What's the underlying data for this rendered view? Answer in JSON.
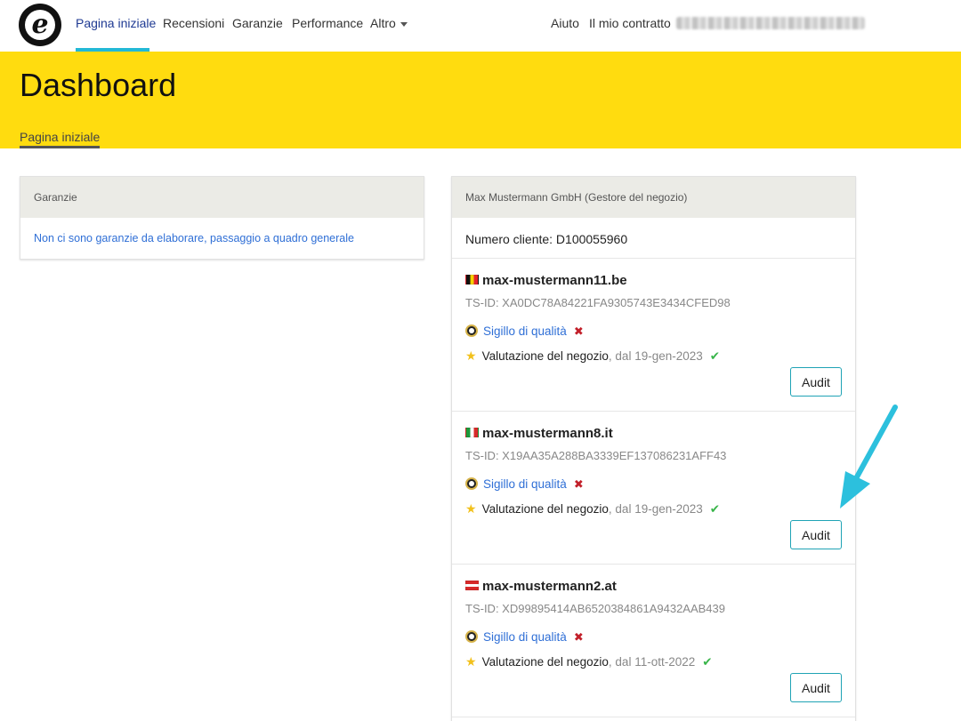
{
  "nav": {
    "logo_letter": "e",
    "items": [
      {
        "label": "Pagina iniziale",
        "active": true
      },
      {
        "label": "Recensioni"
      },
      {
        "label": "Garanzie"
      },
      {
        "label": "Performance"
      },
      {
        "label": "Altro"
      }
    ],
    "right": {
      "help": "Aiuto",
      "contract": "Il mio contratto"
    }
  },
  "header": {
    "title": "Dashboard",
    "subnav": "Pagina iniziale",
    "color": "#ffdc0f"
  },
  "guarantees": {
    "title": "Garanzie",
    "message": "Non ci sono garanzie da elaborare, passaggio a quadro generale"
  },
  "account": {
    "title": "Max Mustermann GmbH (Gestore del negozio)",
    "customer_number": "Numero cliente: D100055960",
    "shops": [
      {
        "flag": "belgium-flag",
        "name": "max-mustermann11.be",
        "tsid": "TS-ID: XA0DC78A84221FA9305743E3434CFED98",
        "seal_label": "Sigillo di qualità",
        "seal_status": "✖",
        "rating_label": "Valutazione del negozio",
        "rating_since": ", dal 19-gen-2023",
        "rating_status": "✔",
        "audit_label": "Audit"
      },
      {
        "flag": "italy-flag",
        "name": "max-mustermann8.it",
        "tsid": "TS-ID: X19AA35A288BA3339EF137086231AFF43",
        "seal_label": "Sigillo di qualità",
        "seal_status": "✖",
        "rating_label": "Valutazione del negozio",
        "rating_since": ", dal 19-gen-2023",
        "rating_status": "✔",
        "audit_label": "Audit"
      },
      {
        "flag": "austria-flag",
        "name": "max-mustermann2.at",
        "tsid": "TS-ID: XD99895414AB6520384861A9432AAB439",
        "seal_label": "Sigillo di qualità",
        "seal_status": "✖",
        "rating_label": "Valutazione del negozio",
        "rating_since": ", dal 11-ott-2022",
        "rating_status": "✔",
        "audit_label": "Audit"
      }
    ]
  },
  "icons": {
    "star": "★",
    "accent": "#22b8d6",
    "arrow_color": "#2cc0dd"
  }
}
